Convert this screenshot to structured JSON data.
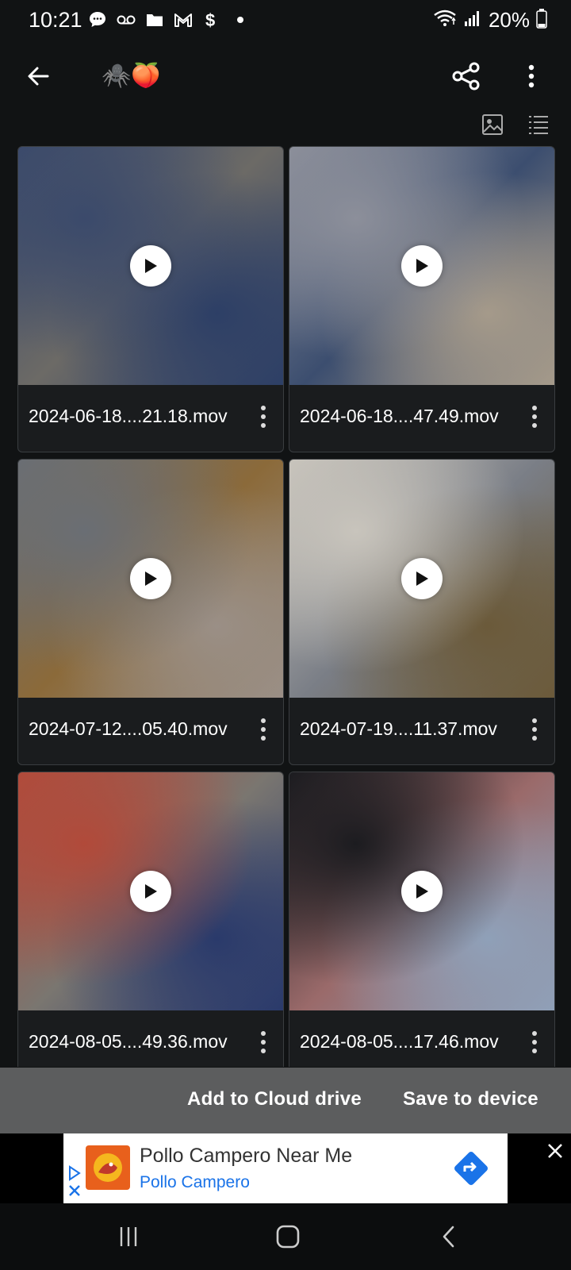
{
  "status_bar": {
    "time": "10:21",
    "battery": "20%",
    "icons": [
      "message-icon",
      "voicemail-icon",
      "folder-icon",
      "gmail-icon",
      "dollar-icon",
      "dot-icon",
      "wifi-icon",
      "signal-icon",
      "battery-icon"
    ]
  },
  "app_bar": {
    "title": "🕷️🍑",
    "back_icon": "arrow-left-icon",
    "share_icon": "share-icon",
    "more_icon": "more-vertical-icon"
  },
  "view_toggles": {
    "icons": [
      "image-view-icon",
      "list-view-icon"
    ]
  },
  "files": [
    {
      "name": "2024-06-18....21.18.mov",
      "colors": [
        "#3b4a6b",
        "#6c6a66",
        "#2d3f66"
      ]
    },
    {
      "name": "2024-06-18....47.49.mov",
      "colors": [
        "#8c8f9a",
        "#3c4e6f",
        "#a59a8a"
      ]
    },
    {
      "name": "2024-07-12....05.40.mov",
      "colors": [
        "#6a6e74",
        "#8b6a3a",
        "#9a8f86"
      ]
    },
    {
      "name": "2024-07-19....11.37.mov",
      "colors": [
        "#c8c4bc",
        "#7a7e86",
        "#6b5a3a"
      ]
    },
    {
      "name": "2024-08-05....49.36.mov",
      "colors": [
        "#b14a3a",
        "#7a7670",
        "#2a3a6b"
      ]
    },
    {
      "name": "2024-08-05....17.46.mov",
      "colors": [
        "#1c1c20",
        "#9a6a6a",
        "#8fa0b8"
      ]
    }
  ],
  "actions": {
    "add_cloud": "Add to Cloud drive",
    "save_device": "Save to device"
  },
  "ad": {
    "title": "Pollo Campero Near Me",
    "subtitle": "Pollo Campero",
    "brand_color": "#e8601c",
    "link_color": "#1a73e8"
  },
  "nav_bar": {
    "icons": [
      "recents-icon",
      "home-icon",
      "back-icon"
    ]
  }
}
